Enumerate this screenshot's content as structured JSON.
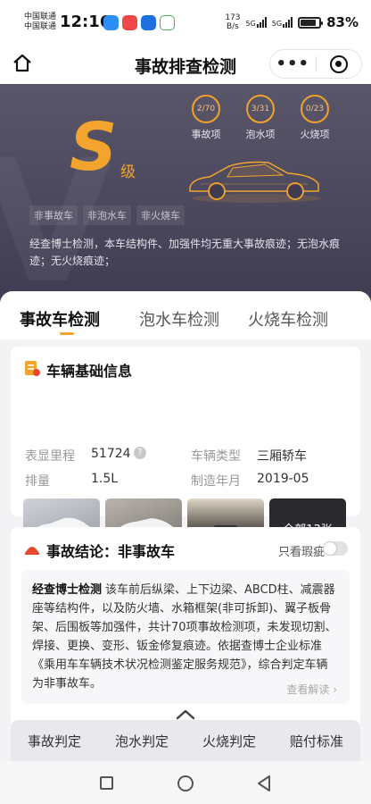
{
  "status_bar": {
    "carrier_1": "中国联通",
    "carrier_2": "中国联通",
    "time": "12:16",
    "net_speed_value": "173",
    "net_speed_unit": "B/s",
    "signal_1": "5G",
    "signal_2": "5G",
    "battery_percent": "83%",
    "battery_level": 0.83,
    "app_icons": [
      "message-app-icon",
      "qq-app-icon",
      "alipay-app-icon",
      "shopping-app-icon"
    ]
  },
  "nav": {
    "title": "事故排查检测",
    "more_label": "•••",
    "home_icon": "home-icon",
    "close_icon": "target-close-icon"
  },
  "hero": {
    "grade": "S",
    "grade_suffix": "级",
    "stats": [
      {
        "value": "2/70",
        "label": "事故项"
      },
      {
        "value": "3/31",
        "label": "泡水项"
      },
      {
        "value": "0/23",
        "label": "火烧项"
      }
    ],
    "chips": [
      "非事故车",
      "非泡水车",
      "非火烧车"
    ],
    "description": "经查博士检测，本车结构件、加强件均无重大事故痕迹；无泡水痕迹；无火烧痕迹；"
  },
  "tabs": {
    "items": [
      "事故车检测",
      "泡水车检测",
      "火烧车检测"
    ],
    "active": 0
  },
  "vehicle_info": {
    "title": "车辆基础信息",
    "mileage_label": "表显里程",
    "mileage_value": "51724",
    "type_label": "车辆类型",
    "type_value": "三厢轿车",
    "displacement_label": "排量",
    "displacement_value": "1.5L",
    "year_label": "制造年月",
    "year_value": "2019-05",
    "help_icon": "?",
    "photos_more": "全部13张"
  },
  "conclusion": {
    "title": "事故结论：非事故车",
    "toggle_label": "只看瑕疵",
    "toggle_on": false,
    "brand": "经查博士检测",
    "text": "该车前后纵梁、上下边梁、ABCD柱、减震器座等结构件，以及防火墙、水箱框架(非可拆卸)、翼子板骨架、后围板等加强件，共计70项事故检测项，未发现切割、焊接、更换、变形、钣金修复痕迹。依据查博士企业标准《乘用车车辆技术状况检测鉴定服务规范》，综合判定车辆为非事故车。",
    "more_link": "查看解读 ›"
  },
  "bottom_tabs": [
    "事故判定",
    "泡水判定",
    "火烧判定",
    "赔付标准"
  ],
  "colors": {
    "accent": "#f3a42c",
    "hero_bg": "#4a475d"
  }
}
